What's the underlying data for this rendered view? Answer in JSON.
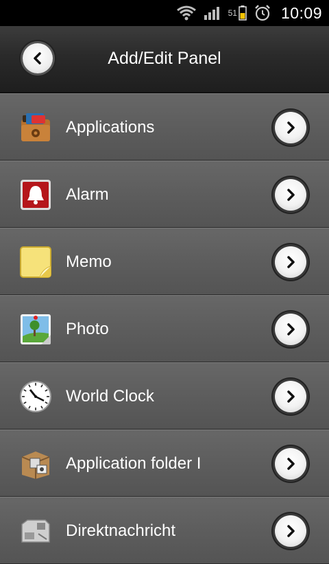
{
  "status_bar": {
    "battery_level": "51",
    "time": "10:09",
    "icons": [
      "wifi-icon",
      "signal-icon",
      "battery-icon",
      "alarm-clock-icon"
    ]
  },
  "header": {
    "title": "Add/Edit Panel",
    "back_icon": "chevron-left-icon"
  },
  "items": [
    {
      "label": "Applications",
      "icon": "applications-folder-icon"
    },
    {
      "label": "Alarm",
      "icon": "alarm-bell-icon"
    },
    {
      "label": "Memo",
      "icon": "memo-note-icon"
    },
    {
      "label": "Photo",
      "icon": "photo-icon"
    },
    {
      "label": "World Clock",
      "icon": "clock-icon"
    },
    {
      "label": "Application folder I",
      "icon": "application-folder-box-icon"
    },
    {
      "label": "Direktnachricht",
      "icon": "direct-message-icon"
    }
  ]
}
